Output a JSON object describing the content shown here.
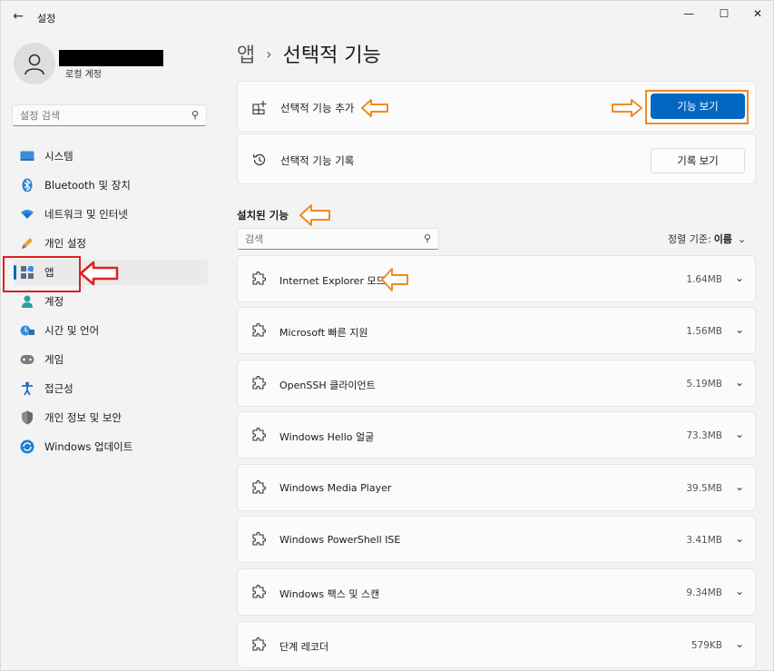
{
  "window": {
    "title": "설정",
    "minimize_glyph": "—",
    "maximize_glyph": "☐",
    "close_glyph": "✕",
    "back_glyph": "←"
  },
  "user": {
    "account_type": "로컬 계정"
  },
  "sidebar": {
    "search_placeholder": "설정 검색",
    "items": [
      {
        "label": "시스템",
        "icon": "system-icon"
      },
      {
        "label": "Bluetooth 및 장치",
        "icon": "bluetooth-icon"
      },
      {
        "label": "네트워크 및 인터넷",
        "icon": "network-icon"
      },
      {
        "label": "개인 설정",
        "icon": "personalization-icon"
      },
      {
        "label": "앱",
        "icon": "apps-icon",
        "selected": true
      },
      {
        "label": "계정",
        "icon": "account-icon"
      },
      {
        "label": "시간 및 언어",
        "icon": "time-language-icon"
      },
      {
        "label": "게임",
        "icon": "gaming-icon"
      },
      {
        "label": "접근성",
        "icon": "accessibility-icon"
      },
      {
        "label": "개인 정보 및 보안",
        "icon": "privacy-shield-icon"
      },
      {
        "label": "Windows 업데이트",
        "icon": "windows-update-icon"
      }
    ]
  },
  "breadcrumb": {
    "parent": "앱",
    "separator": "›",
    "current": "선택적 기능"
  },
  "add_feature": {
    "label": "선택적 기능 추가",
    "button": "기능 보기"
  },
  "history": {
    "label": "선택적 기능 기록",
    "button": "기록 보기"
  },
  "installed": {
    "title": "설치된 기능",
    "search_placeholder": "검색",
    "sort_label": "정렬 기준:",
    "sort_value": "이름",
    "features": [
      {
        "name": "Internet Explorer 모드",
        "size": "1.64MB"
      },
      {
        "name": "Microsoft 빠른 지원",
        "size": "1.56MB"
      },
      {
        "name": "OpenSSH 클라이언트",
        "size": "5.19MB"
      },
      {
        "name": "Windows Hello 얼굴",
        "size": "73.3MB"
      },
      {
        "name": "Windows Media Player",
        "size": "39.5MB"
      },
      {
        "name": "Windows PowerShell ISE",
        "size": "3.41MB"
      },
      {
        "name": "Windows 팩스 및 스캔",
        "size": "9.34MB"
      },
      {
        "name": "단계 레코더",
        "size": "579KB"
      }
    ]
  },
  "colors": {
    "accent": "#0067c0",
    "annotation_orange": "#f08a24",
    "annotation_red": "#e02020"
  }
}
